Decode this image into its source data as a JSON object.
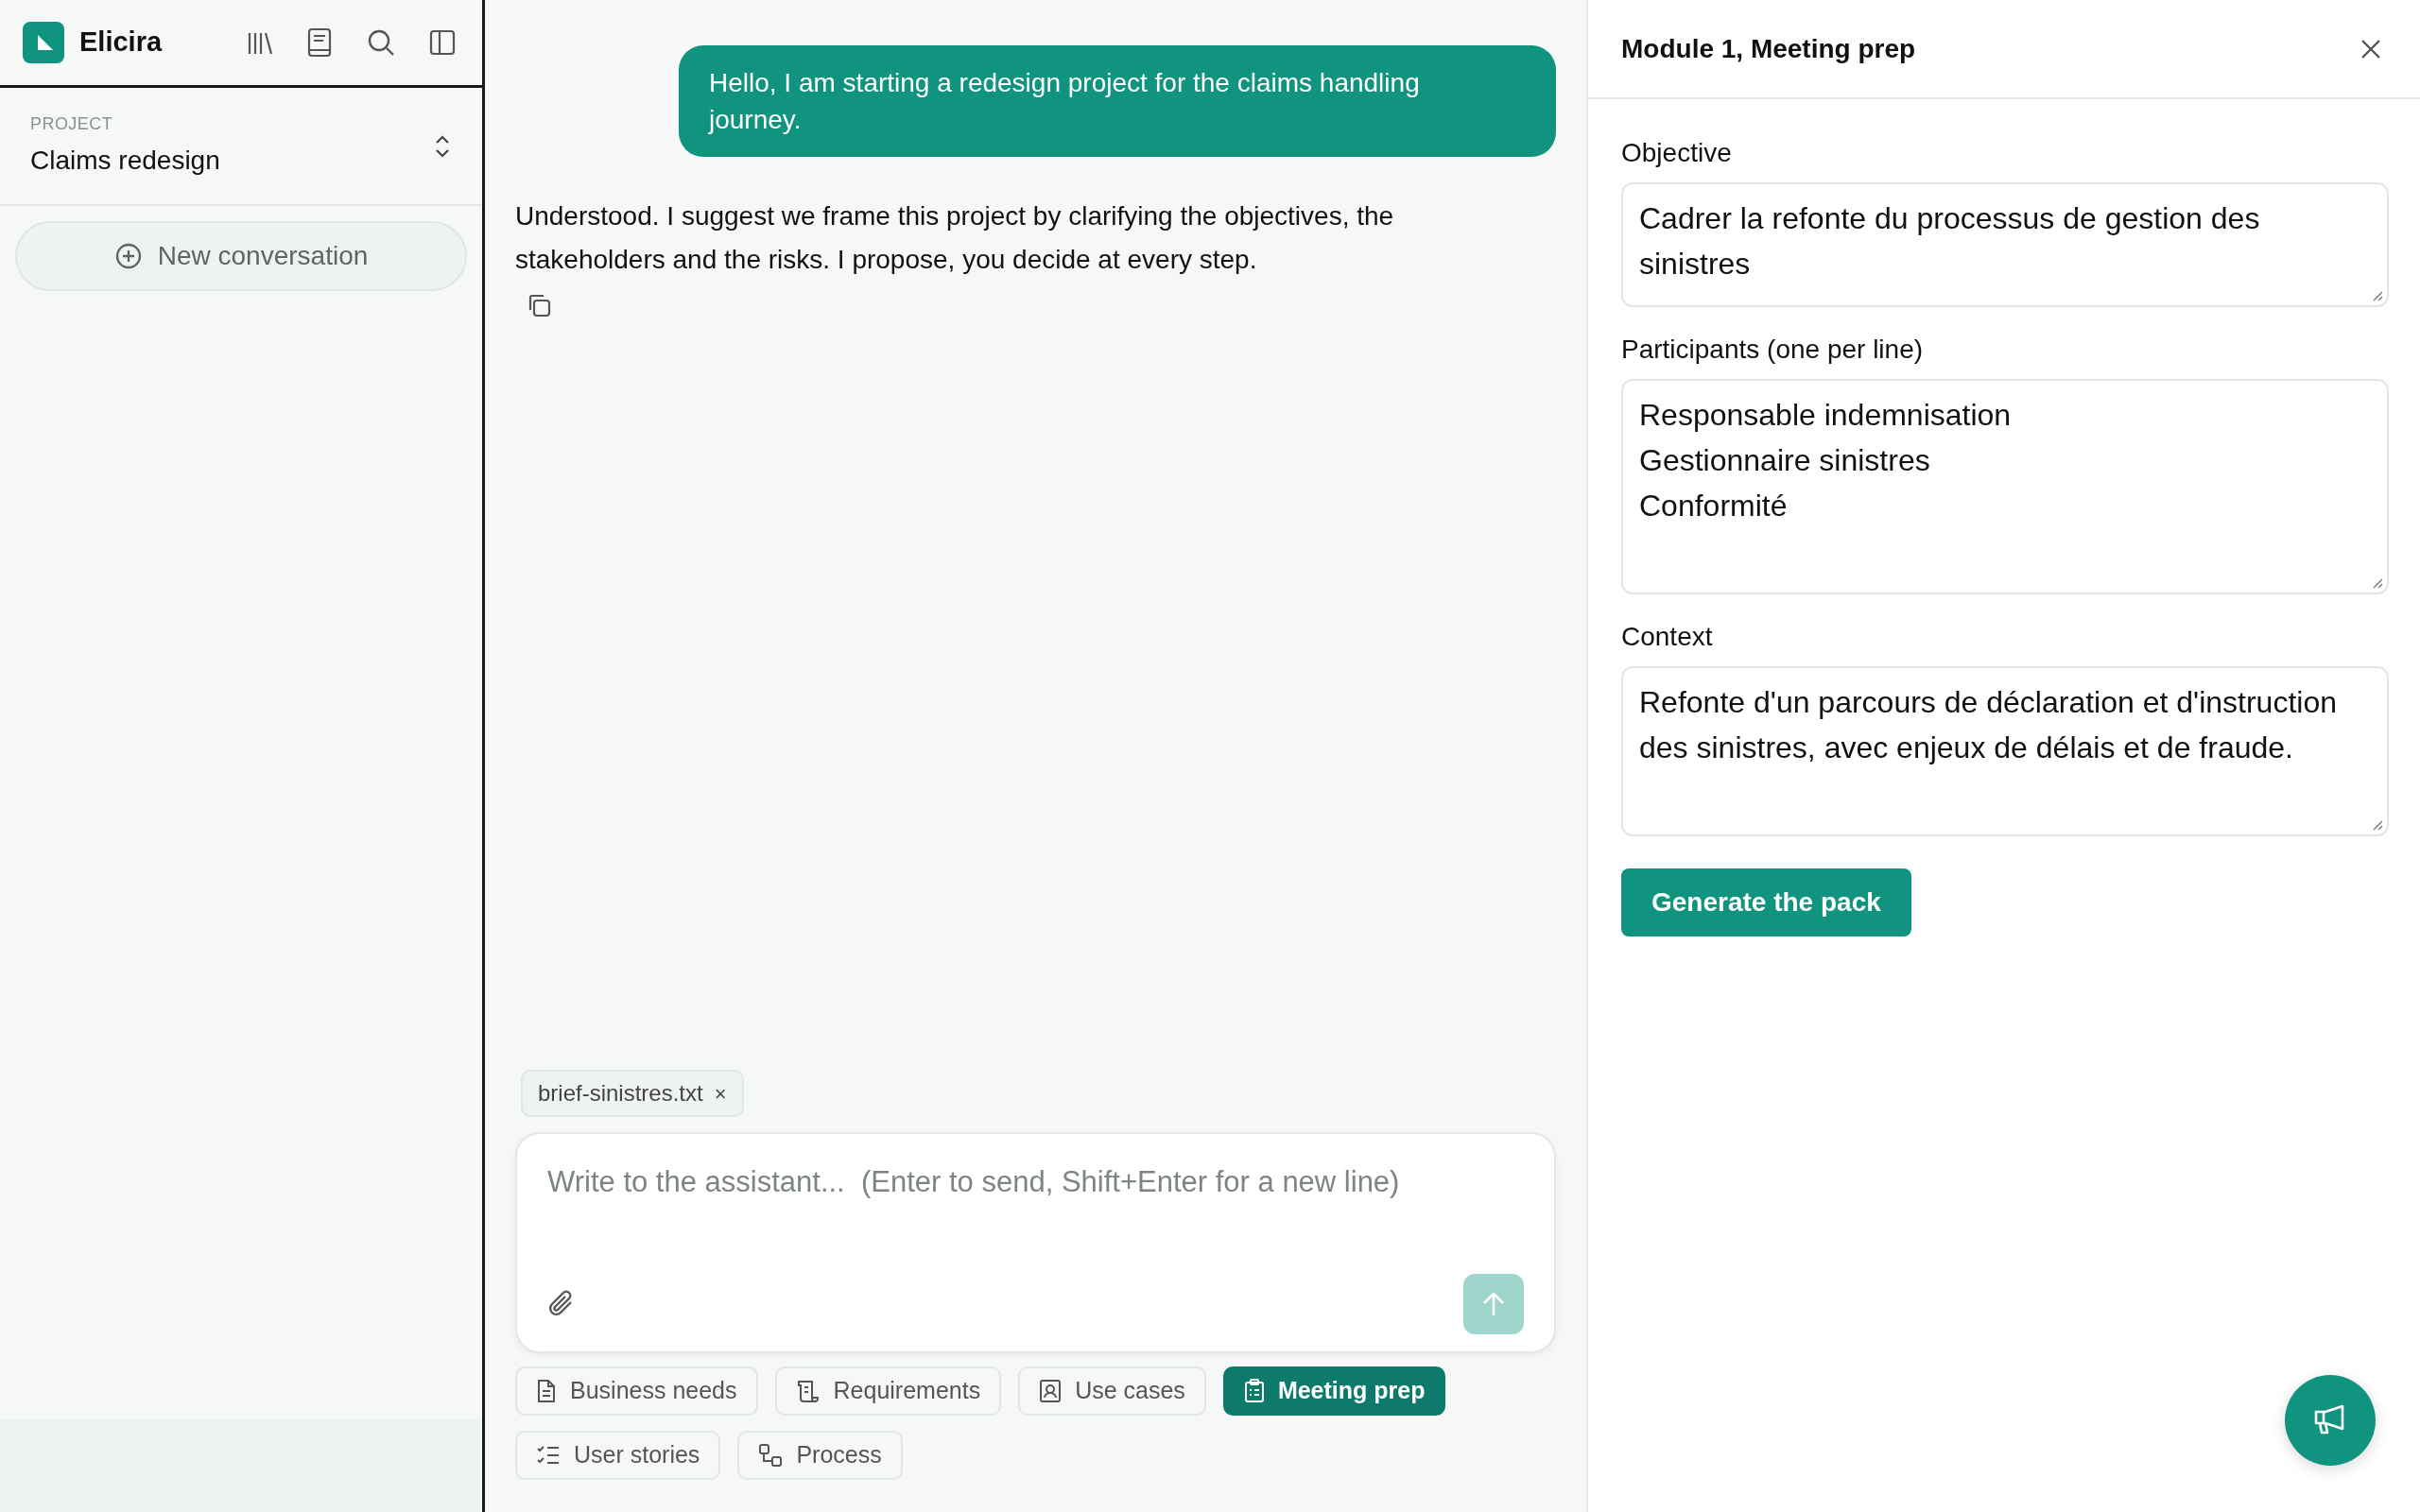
{
  "sidebar": {
    "app_name": "Elicira",
    "project_label": "PROJECT",
    "project_name": "Claims redesign",
    "new_conversation": "New conversation"
  },
  "messages": [
    {
      "kind": "user",
      "text": "Hello, I am starting a redesign project for the claims handling journey."
    },
    {
      "kind": "assistant",
      "text": "Understood. I suggest we frame this project by clarifying the objectives, the stakeholders and the risks. I propose, you decide at every step."
    }
  ],
  "attachments": [
    {
      "name": "brief-sinistres.txt",
      "remove": "×"
    }
  ],
  "composer": {
    "placeholder": "Write to the assistant...  (Enter to send, Shift+Enter for a new line)"
  },
  "modules": [
    {
      "label": "Business needs",
      "selected": false
    },
    {
      "label": "Requirements",
      "selected": false
    },
    {
      "label": "Use cases",
      "selected": false
    },
    {
      "label": "Meeting prep",
      "selected": true
    },
    {
      "label": "User stories",
      "selected": false
    },
    {
      "label": "Process",
      "selected": false
    }
  ],
  "panel": {
    "title": "Module 1, Meeting prep",
    "fields": [
      {
        "label": "Objective",
        "value": "Cadrer la refonte du processus de gestion des sinistres"
      },
      {
        "label": "Participants (one per line)",
        "value": "Responsable indemnisation\nGestionnaire sinistres\nConformité"
      },
      {
        "label": "Context",
        "value": "Refonte d'un parcours de déclaration et d'instruction des sinistres, avec enjeux de délais et de fraude."
      }
    ],
    "button": "Generate the pack"
  }
}
